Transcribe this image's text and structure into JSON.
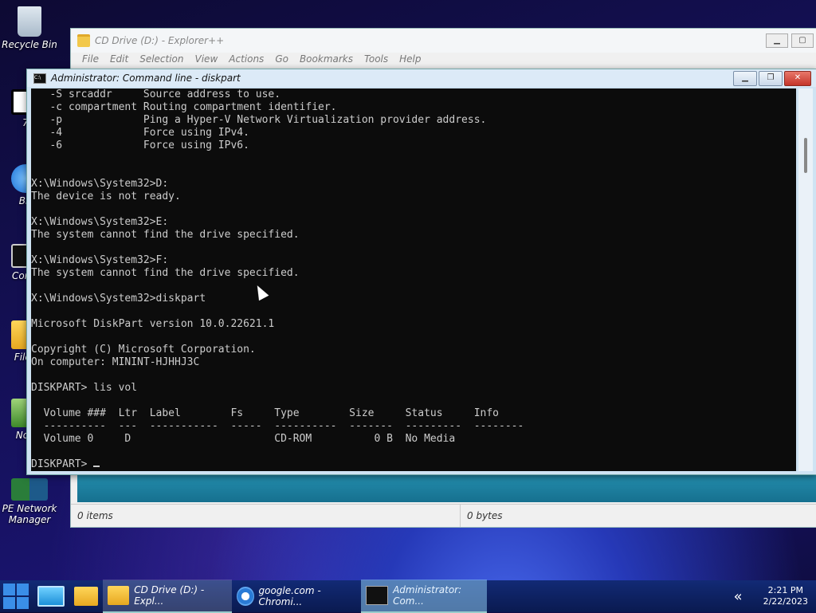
{
  "desktop": {
    "icons": [
      {
        "label": "Recycle Bin"
      },
      {
        "label": "7-"
      },
      {
        "label": "Bro"
      },
      {
        "label": "Com L"
      },
      {
        "label": "File b"
      },
      {
        "label": "Note"
      },
      {
        "label": "PE Network Manager"
      }
    ]
  },
  "explorer": {
    "title": "CD Drive (D:) - Explorer++",
    "menu": [
      "File",
      "Edit",
      "Selection",
      "View",
      "Actions",
      "Go",
      "Bookmarks",
      "Tools",
      "Help"
    ],
    "status_items": "0 items",
    "status_bytes": "0 bytes"
  },
  "cmd": {
    "title": "Administrator: Command line - diskpart",
    "lines": [
      "   -S srcaddr     Source address to use.",
      "   -c compartment Routing compartment identifier.",
      "   -p             Ping a Hyper-V Network Virtualization provider address.",
      "   -4             Force using IPv4.",
      "   -6             Force using IPv6.",
      "",
      "",
      "X:\\Windows\\System32>D:",
      "The device is not ready.",
      "",
      "X:\\Windows\\System32>E:",
      "The system cannot find the drive specified.",
      "",
      "X:\\Windows\\System32>F:",
      "The system cannot find the drive specified.",
      "",
      "X:\\Windows\\System32>diskpart",
      "",
      "Microsoft DiskPart version 10.0.22621.1",
      "",
      "Copyright (C) Microsoft Corporation.",
      "On computer: MININT-HJHHJ3C",
      "",
      "DISKPART> lis vol",
      "",
      "  Volume ###  Ltr  Label        Fs     Type        Size     Status     Info",
      "  ----------  ---  -----------  -----  ----------  -------  ---------  --------",
      "  Volume 0     D                       CD-ROM          0 B  No Media",
      ""
    ],
    "prompt": "DISKPART> "
  },
  "taskbar": {
    "items": [
      {
        "label": "CD Drive (D:) - Expl..."
      },
      {
        "label": "google.com - Chromi..."
      },
      {
        "label": "Administrator: Com..."
      }
    ],
    "time": "2:21 PM",
    "date": "2/22/2023",
    "overflow_icon": "chevron-double-left-icon"
  }
}
